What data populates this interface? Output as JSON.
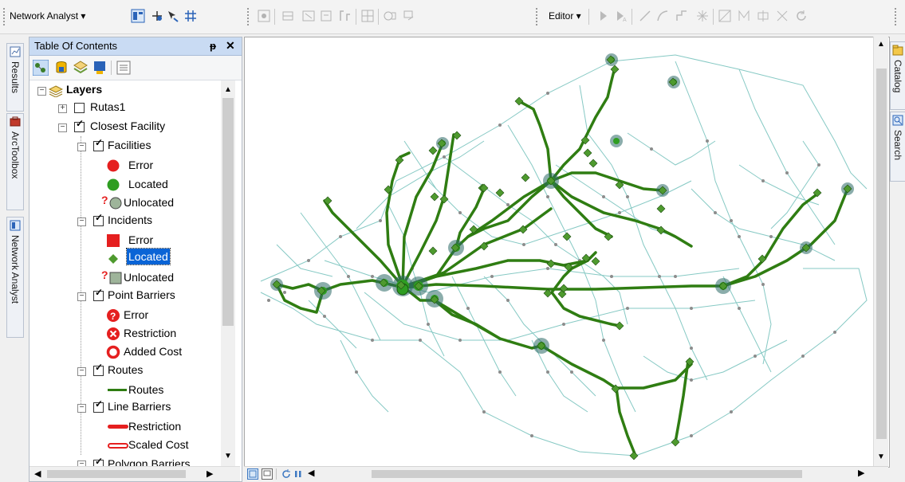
{
  "toolbar": {
    "network_analyst_label": "Network Analyst ▾",
    "editor_label": "Editor ▾"
  },
  "left_tabs": {
    "results": "Results",
    "arctoolbox": "ArcToolbox",
    "network_analyst": "Network Analyst"
  },
  "right_tabs": {
    "catalog": "Catalog",
    "search": "Search"
  },
  "toc": {
    "title": "Table Of Contents",
    "pin": "ᵽ",
    "close": "✕",
    "items": [
      {
        "label": "Layers"
      },
      {
        "label": "Rutas1"
      },
      {
        "label": "Closest Facility"
      },
      {
        "label": "Facilities"
      },
      {
        "label": "Error"
      },
      {
        "label": "Located"
      },
      {
        "label": "Unlocated"
      },
      {
        "label": "Incidents"
      },
      {
        "label": "Error"
      },
      {
        "label": "Located"
      },
      {
        "label": "Unlocated"
      },
      {
        "label": "Point Barriers"
      },
      {
        "label": "Error"
      },
      {
        "label": "Restriction"
      },
      {
        "label": "Added Cost"
      },
      {
        "label": "Routes"
      },
      {
        "label": "Routes"
      },
      {
        "label": "Line Barriers"
      },
      {
        "label": "Restriction"
      },
      {
        "label": "Scaled Cost"
      }
    ],
    "cut_off_item": "Polygon Barriers"
  },
  "colors": {
    "route_green": "#2f7d12",
    "road_teal": "#86c9c4",
    "facility_green": "#2e9d21",
    "error_red": "#e51f1f",
    "selection_blue": "#0a64d6"
  }
}
